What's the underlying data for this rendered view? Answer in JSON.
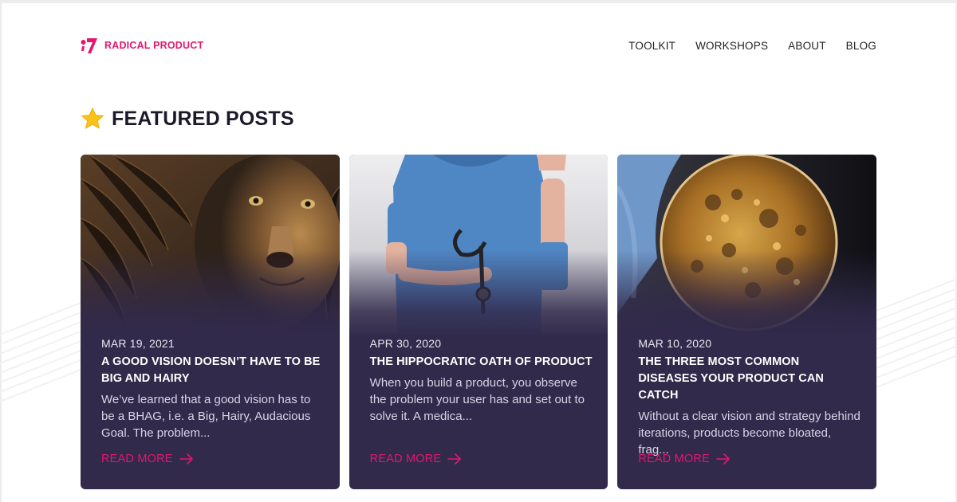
{
  "brand": {
    "name": "RADICAL PRODUCT",
    "color": "#e5166f",
    "logo_icon": "radical-product-logo-icon"
  },
  "nav": {
    "items": [
      {
        "label": "TOOLKIT"
      },
      {
        "label": "WORKSHOPS"
      },
      {
        "label": "ABOUT"
      },
      {
        "label": "BLOG"
      }
    ]
  },
  "section": {
    "title": "FEATURED POSTS",
    "icon": "star-icon"
  },
  "theme": {
    "card_bg": "#312a4b",
    "accent": "#e5166f",
    "star": "#f7c21a"
  },
  "posts": [
    {
      "date": "MAR 19, 2021",
      "title": "A GOOD VISION DOESN’T HAVE TO BE BIG AND HAIRY",
      "excerpt": "We’ve learned that a good vision has to be a BHAG, i.e. a Big, Hairy, Audacious Goal. The problem...",
      "read_more": "READ MORE",
      "image": "lion-photo"
    },
    {
      "date": "APR 30, 2020",
      "title": "THE HIPPOCRATIC OATH OF PRODUCT",
      "excerpt": "When you build a product, you observe the problem your user has and set out to solve it. A medica...",
      "read_more": "READ MORE",
      "image": "doctor-photo"
    },
    {
      "date": "MAR 10, 2020",
      "title": "THE THREE MOST COMMON DISEASES YOUR PRODUCT CAN CATCH",
      "excerpt": "Without a clear vision and strategy behind iterations, products become bloated, frag...",
      "read_more": "READ MORE",
      "image": "petri-dish-photo"
    }
  ]
}
